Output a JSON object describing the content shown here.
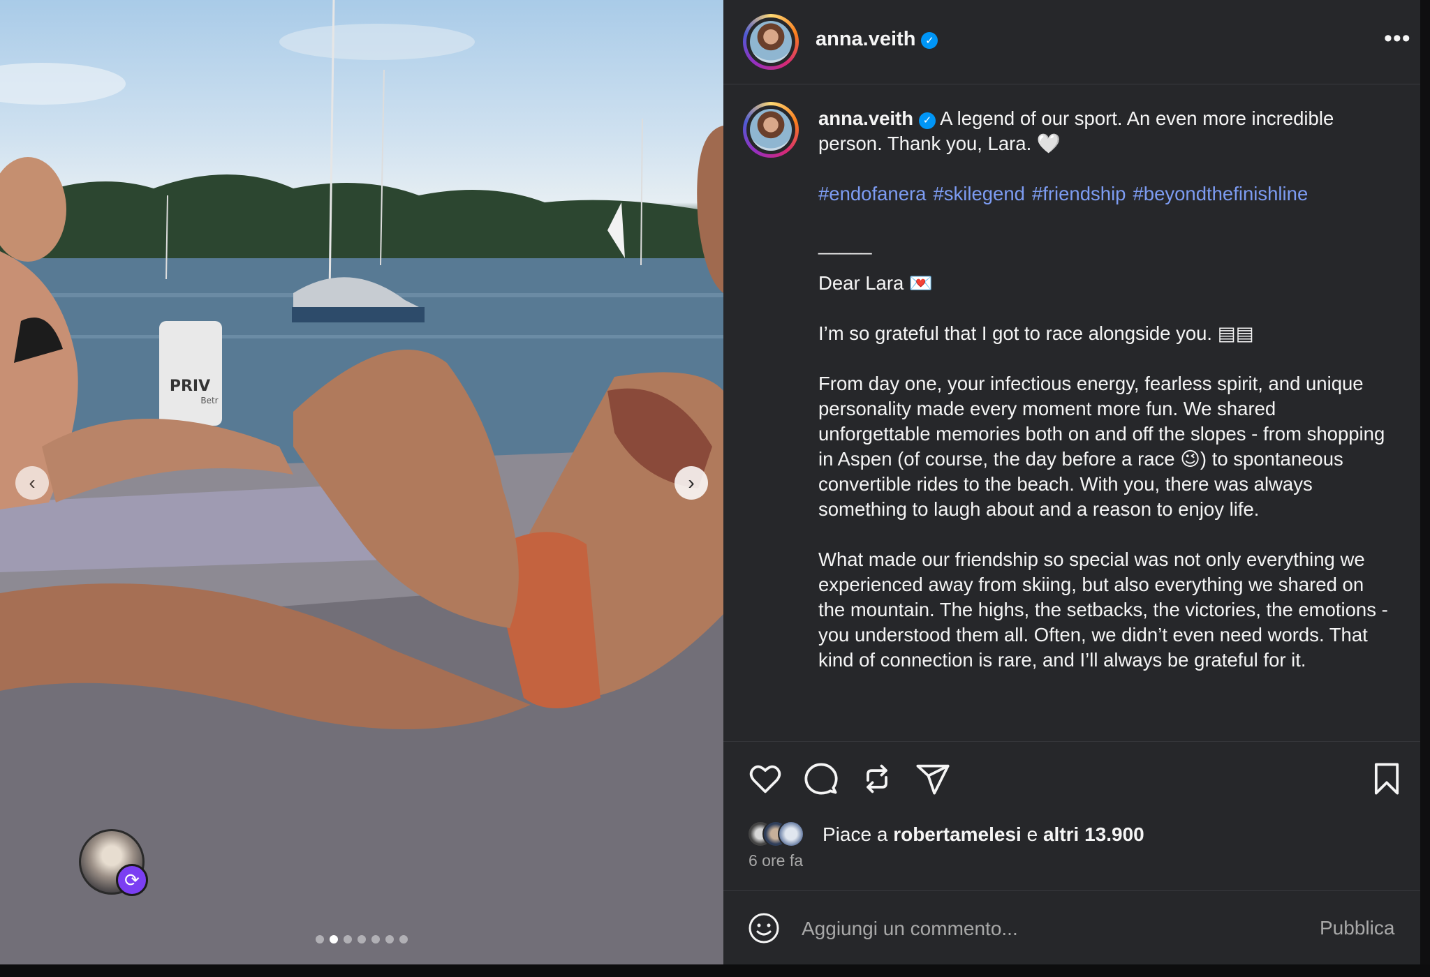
{
  "post": {
    "username": "anna.veith",
    "verified_mark": "✓",
    "more_icon": "•••"
  },
  "photo": {
    "sign_text": "PRIV",
    "sign_subtext": "Betr",
    "carousel_count": 7,
    "carousel_active_index": 1
  },
  "caption": {
    "username": "anna.veith",
    "intro": "A legend of our sport. An even more incredible person. Thank you, Lara. 🤍",
    "hashtags": [
      "#endofanera",
      "#skilegend",
      "#friendship",
      "#beyondthefinishline"
    ],
    "separator": "_____",
    "greeting": "Dear Lara 💌",
    "line1": "I’m so grateful that I got to race alongside you. ▤▤",
    "para1": "From day one, your infectious energy, fearless spirit, and unique personality made every moment more fun. We shared unforgettable memories both on and off the slopes - from shopping in Aspen (of course, the day before a race 😉) to spontaneous convertible rides to the beach. With you, there was always something to laugh about and a reason to enjoy life.",
    "para2": "What made our friendship so special was not only everything we experienced away from skiing, but also everything we shared on the mountain. The highs, the setbacks, the victories, the emotions - you understood them all. Often, we didn’t even need words. That kind of connection is rare, and I’ll always be grateful for it."
  },
  "actions": {
    "like": "heart-icon",
    "comment": "comment-icon",
    "repost": "repost-icon",
    "share": "share-icon",
    "save": "bookmark-icon"
  },
  "likes": {
    "prefix": "Piace a",
    "first_user": "robertamelesi",
    "connector": "e",
    "others": "altri 13.900"
  },
  "time_ago": "6 ore fa",
  "comment": {
    "placeholder": "Aggiungi un commento...",
    "publish_label": "Pubblica"
  },
  "colors": {
    "panel_bg": "#26272a",
    "hashtag": "#7d9cf2",
    "verified": "#0095f6",
    "repost_badge": "#7b3ff2"
  }
}
